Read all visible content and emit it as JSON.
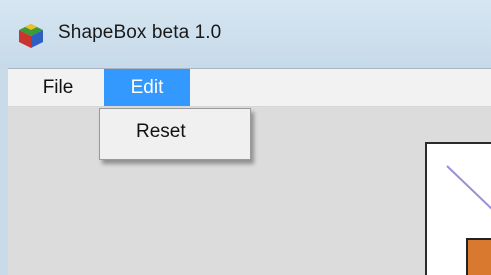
{
  "window": {
    "title": "ShapeBox beta 1.0",
    "icon": "cube-app-icon"
  },
  "menubar": {
    "items": [
      {
        "label": "File",
        "active": false
      },
      {
        "label": "Edit",
        "active": true
      }
    ]
  },
  "edit_menu": {
    "items": [
      {
        "label": "Reset"
      }
    ]
  },
  "colors": {
    "title_bar": "#c9dbe9",
    "menu_highlight": "#3399ff",
    "shape_line": "#9b8fd8",
    "shape_fill": "#d9782f"
  }
}
